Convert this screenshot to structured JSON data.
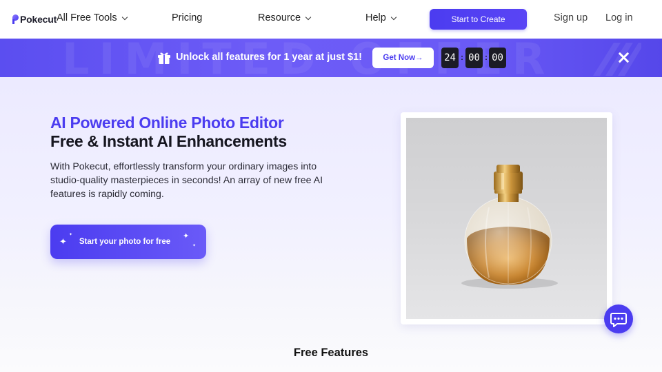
{
  "nav": {
    "brand": "Pokecut",
    "items": [
      {
        "label": "All Free Tools",
        "has_dropdown": true
      },
      {
        "label": "Pricing",
        "has_dropdown": false
      },
      {
        "label": "Resource",
        "has_dropdown": true
      },
      {
        "label": "Help",
        "has_dropdown": true
      }
    ],
    "cta": "Start to Create",
    "sign_up": "Sign up",
    "log_in": "Log in"
  },
  "promo": {
    "watermark": "LIMITED OFFER",
    "text": "Unlock all features for 1 year at just $1!",
    "button": "Get Now→",
    "timer": {
      "hours": "24",
      "minutes": "00",
      "seconds": "00"
    },
    "icon": "gift-icon",
    "close_icon": "close-icon"
  },
  "hero": {
    "title": "AI Powered Online Photo Editor",
    "subtitle": "Free & Instant AI Enhancements",
    "description": "With Pokecut, effortlessly transform your ordinary images into studio-quality masterpieces in seconds! An array of new free AI features is rapidly coming.",
    "cta": "Start your photo for free",
    "image_icon": "perfume-bottle-image"
  },
  "chat": {
    "icon": "chat-icon"
  },
  "features": {
    "title": "Free Features"
  },
  "colors": {
    "brand": "#4b3cf0",
    "promo_bg": "#6a5af6",
    "hero_bg": "#eceaff",
    "text_dark": "#15151f"
  }
}
